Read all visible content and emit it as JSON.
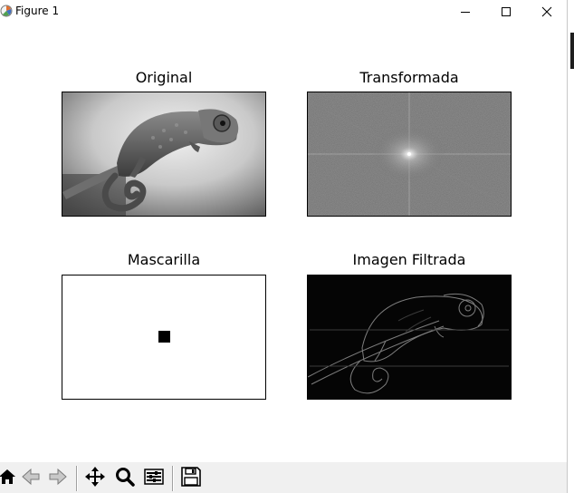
{
  "window": {
    "title": "Figure 1",
    "controls": {
      "minimize": "minimize",
      "maximize": "maximize",
      "close": "close"
    }
  },
  "figure": {
    "subplots": [
      {
        "title": "Original",
        "image": "chameleon-grayscale"
      },
      {
        "title": "Transformada",
        "image": "fourier-spectrum"
      },
      {
        "title": "Mascarilla",
        "image": "mask-white-with-black-square"
      },
      {
        "title": "Imagen Filtrada",
        "image": "filtered-chameleon-edges"
      }
    ]
  },
  "toolbar": {
    "buttons": [
      {
        "name": "home",
        "icon": "home-icon"
      },
      {
        "name": "back",
        "icon": "back-arrow-icon"
      },
      {
        "name": "forward",
        "icon": "forward-arrow-icon"
      },
      {
        "name": "pan",
        "icon": "move-icon"
      },
      {
        "name": "zoom",
        "icon": "zoom-icon"
      },
      {
        "name": "configure-subplots",
        "icon": "sliders-icon"
      },
      {
        "name": "save",
        "icon": "save-icon"
      }
    ]
  },
  "colors": {
    "window_bg": "#ffffff",
    "toolbar_bg": "#f0f0f0",
    "axes_border": "#000000"
  }
}
